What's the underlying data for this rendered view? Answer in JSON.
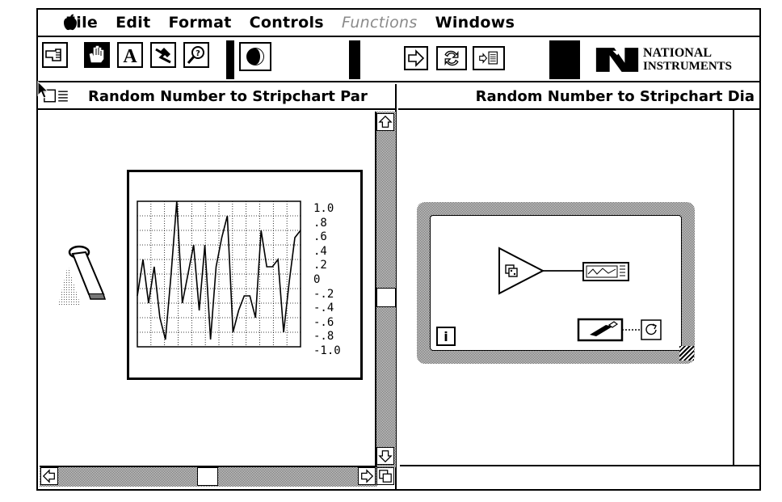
{
  "menubar": {
    "items": [
      {
        "label": "File",
        "enabled": true
      },
      {
        "label": "Edit",
        "enabled": true
      },
      {
        "label": "Format",
        "enabled": true
      },
      {
        "label": "Controls",
        "enabled": true
      },
      {
        "label": "Functions",
        "enabled": false
      },
      {
        "label": "Windows",
        "enabled": true
      }
    ]
  },
  "toolbar": {
    "tools": [
      "operate-hand-icon",
      "position-hand-icon",
      "text-tool-icon",
      "wire-tool-icon",
      "probe-icon",
      "color-tool-icon"
    ],
    "selected_tool": "position-hand-icon",
    "run_controls": [
      "run-arrow-icon",
      "continuous-run-icon",
      "step-icon"
    ],
    "logo_line1": "NATIONAL",
    "logo_line2": "INSTRUMENTS"
  },
  "front_panel": {
    "title": "Random Number to Stripchart Par",
    "chart": {
      "y_ticks": [
        "1.0",
        ".8",
        ".6",
        ".4",
        ".2",
        "0",
        "-.2",
        "-.4",
        "-.6",
        "-.8",
        "-1.0"
      ]
    }
  },
  "diagram": {
    "title": "Random Number to Stripchart Dia",
    "iteration_label": "i"
  },
  "chart_data": {
    "type": "line",
    "ylim": [
      -1.0,
      1.0
    ],
    "series": [
      {
        "values": [
          -0.3,
          0.2,
          -0.4,
          0.1,
          -0.6,
          -0.9,
          0.0,
          1.0,
          -0.4,
          0.0,
          0.4,
          -0.5,
          0.4,
          -0.9,
          0.1,
          0.5,
          0.8,
          -0.8,
          -0.5,
          -0.3,
          -0.3,
          -0.6,
          0.6,
          0.1,
          0.1,
          0.2,
          -0.8,
          -0.1,
          0.5,
          0.6
        ]
      }
    ]
  }
}
